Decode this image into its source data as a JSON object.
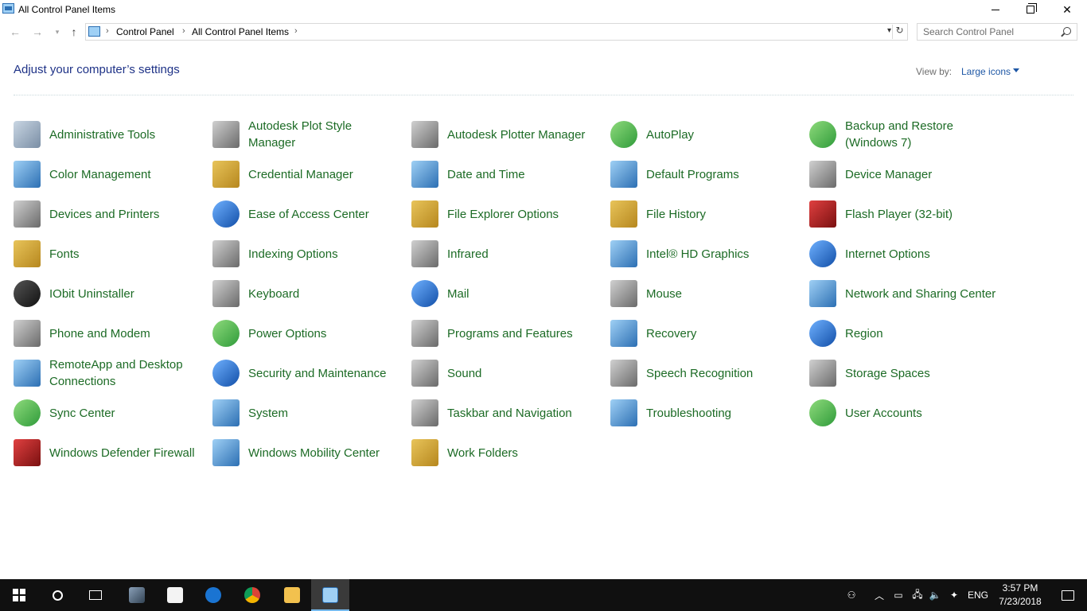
{
  "window": {
    "title": "All Control Panel Items"
  },
  "nav": {
    "back_icon": "back-arrow-icon",
    "forward_icon": "forward-arrow-icon",
    "up_icon": "up-arrow-icon"
  },
  "address": {
    "crumbs": [
      "Control Panel",
      "All Control Panel Items"
    ],
    "separator": "›"
  },
  "search": {
    "placeholder": "Search Control Panel"
  },
  "header": {
    "title": "Adjust your computer’s settings",
    "view_by_label": "View by:",
    "view_by_value": "Large icons"
  },
  "items": [
    "Administrative Tools",
    "Autodesk Plot Style Manager",
    "Autodesk Plotter Manager",
    "AutoPlay",
    "Backup and Restore (Windows 7)",
    "Color Management",
    "Credential Manager",
    "Date and Time",
    "Default Programs",
    "Device Manager",
    "Devices and Printers",
    "Ease of Access Center",
    "File Explorer Options",
    "File History",
    "Flash Player (32-bit)",
    "Fonts",
    "Indexing Options",
    "Infrared",
    "Intel® HD Graphics",
    "Internet Options",
    "IObit Uninstaller",
    "Keyboard",
    "Mail",
    "Mouse",
    "Network and Sharing Center",
    "Phone and Modem",
    "Power Options",
    "Programs and Features",
    "Recovery",
    "Region",
    "RemoteApp and Desktop Connections",
    "Security and Maintenance",
    "Sound",
    "Speech Recognition",
    "Storage Spaces",
    "Sync Center",
    "System",
    "Taskbar and Navigation",
    "Troubleshooting",
    "User Accounts",
    "Windows Defender Firewall",
    "Windows Mobility Center",
    "Work Folders"
  ],
  "taskbar": {
    "language": "ENG",
    "time": "3:57 PM",
    "date": "7/23/2018"
  },
  "colors": {
    "item_link": "#1c6b25",
    "heading": "#1e3287",
    "taskbar": "#101010"
  }
}
